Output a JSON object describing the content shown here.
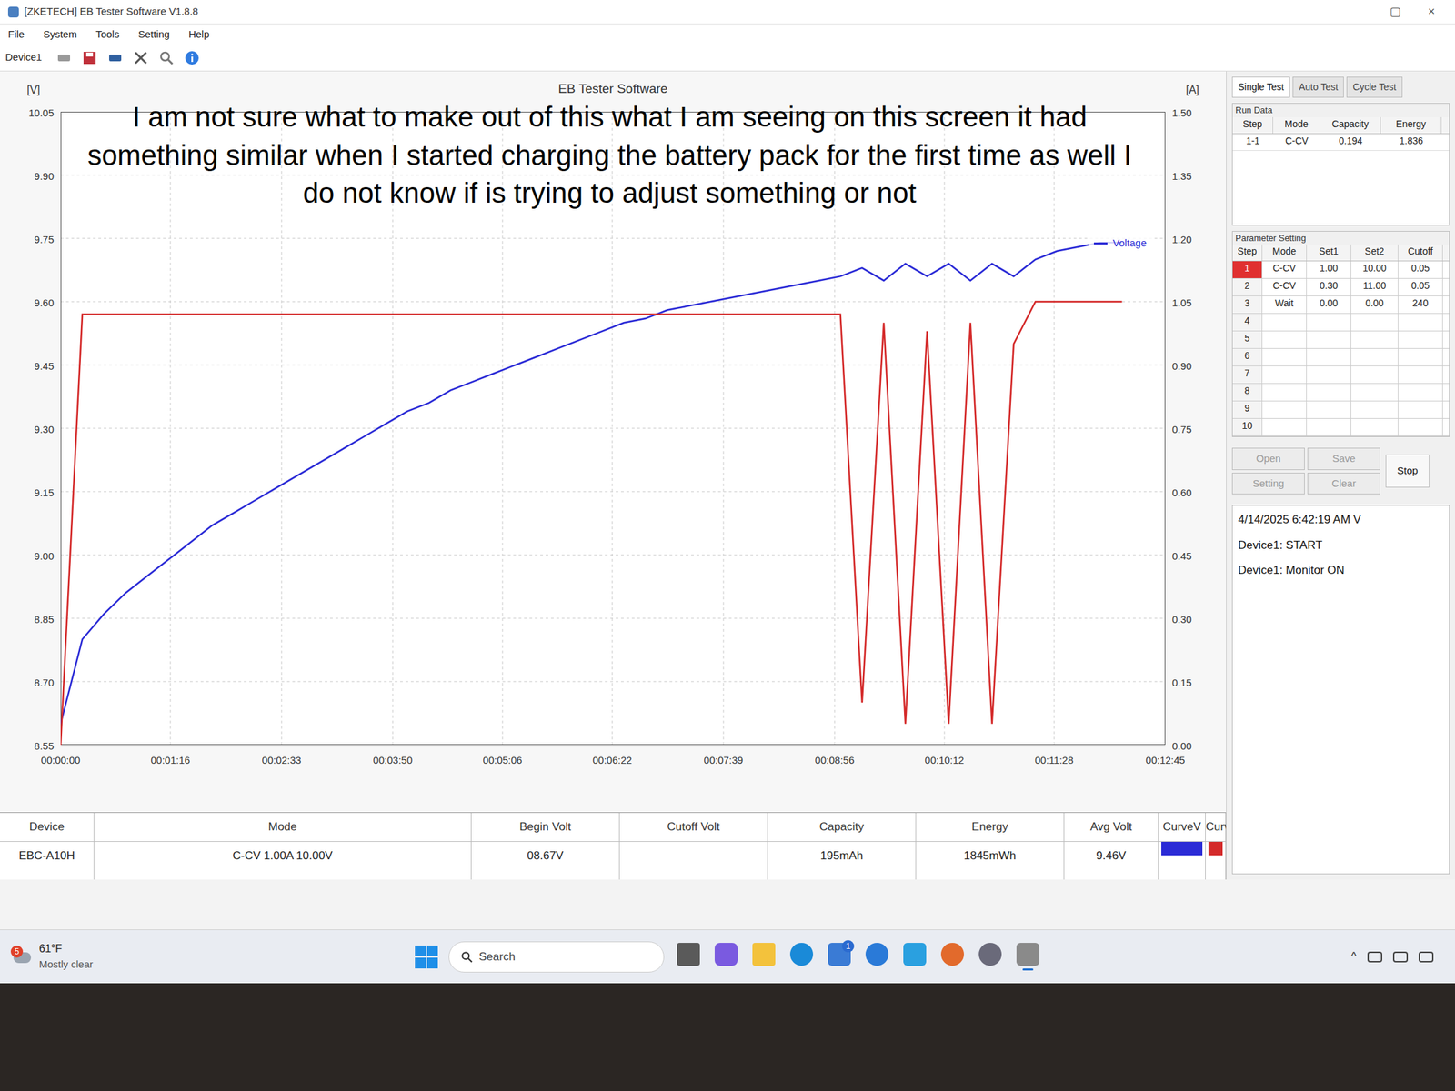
{
  "window": {
    "title": "[ZKETECH] EB Tester Software V1.8.8",
    "controls": [
      "▢",
      "×"
    ]
  },
  "menu": [
    "File",
    "System",
    "Tools",
    "Setting",
    "Help"
  ],
  "toolbar": {
    "device": "Device1"
  },
  "caption": "I am not sure what to make out of this what I am seeing on this screen it had something similar when I started charging the battery pack for the first time as well I do not know if is trying to adjust something or not",
  "chart": {
    "title": "EB Tester Software",
    "left_unit": "[V]",
    "right_unit": "[A]",
    "left_ticks": [
      "8.55",
      "8.70",
      "8.85",
      "9.00",
      "9.15",
      "9.30",
      "9.45",
      "9.60",
      "9.75",
      "9.90",
      "10.05"
    ],
    "right_ticks": [
      "0.00",
      "0.15",
      "0.30",
      "0.45",
      "0.60",
      "0.75",
      "0.90",
      "1.05",
      "1.20",
      "1.35",
      "1.50"
    ],
    "time_ticks": [
      "00:00:00",
      "00:01:16",
      "00:02:33",
      "00:03:50",
      "00:05:06",
      "00:06:22",
      "00:07:39",
      "00:08:56",
      "00:10:12",
      "00:11:28",
      "00:12:45"
    ],
    "series": [
      {
        "legend": "Voltage",
        "axis": "left",
        "color": "#2b2bd6",
        "values": [
          8.6,
          8.8,
          8.86,
          8.91,
          8.95,
          8.99,
          9.03,
          9.07,
          9.1,
          9.13,
          9.16,
          9.19,
          9.22,
          9.25,
          9.28,
          9.31,
          9.34,
          9.36,
          9.39,
          9.41,
          9.43,
          9.45,
          9.47,
          9.49,
          9.51,
          9.53,
          9.55,
          9.56,
          9.58,
          9.59,
          9.6,
          9.61,
          9.62,
          9.63,
          9.64,
          9.65,
          9.66,
          9.68,
          9.65,
          9.69,
          9.66,
          9.69,
          9.65,
          9.69,
          9.66,
          9.7,
          9.72,
          9.73,
          9.74,
          9.74
        ]
      },
      {
        "legend": "",
        "axis": "right",
        "color": "#d42a2a",
        "values": [
          0.0,
          1.02,
          1.02,
          1.02,
          1.02,
          1.02,
          1.02,
          1.02,
          1.02,
          1.02,
          1.02,
          1.02,
          1.02,
          1.02,
          1.02,
          1.02,
          1.02,
          1.02,
          1.02,
          1.02,
          1.02,
          1.02,
          1.02,
          1.02,
          1.02,
          1.02,
          1.02,
          1.02,
          1.02,
          1.02,
          1.02,
          1.02,
          1.02,
          1.02,
          1.02,
          1.02,
          1.02,
          0.1,
          1.0,
          0.05,
          0.98,
          0.05,
          1.0,
          0.05,
          0.95,
          1.05,
          1.05,
          1.05,
          1.05,
          1.05
        ]
      }
    ]
  },
  "summary": {
    "columns": [
      "Device",
      "Mode",
      "Begin Volt",
      "Cutoff Volt",
      "Capacity",
      "Energy",
      "Avg Volt",
      "CurveV",
      "CurveA"
    ],
    "values": [
      "EBC-A10H",
      "C-CV 1.00A 10.00V",
      "08.67V",
      "",
      "195mAh",
      "1845mWh",
      "9.46V"
    ]
  },
  "side_tabs": [
    {
      "label": "Single Test",
      "selected": true
    },
    {
      "label": "Auto Test",
      "selected": false
    },
    {
      "label": "Cycle Test",
      "selected": false
    }
  ],
  "run_data": {
    "title": "Run Data",
    "columns": [
      "Step",
      "Mode",
      "Capacity",
      "Energy"
    ],
    "rows": [
      [
        "1-1",
        "C-CV",
        "0.194",
        "1.836"
      ]
    ]
  },
  "parameters": {
    "title": "Parameter Setting",
    "columns": [
      "Step",
      "Mode",
      "Set1",
      "Set2",
      "Cutoff"
    ],
    "rows": [
      {
        "cells": [
          "1",
          "C-CV",
          "1.00",
          "10.00",
          "0.05"
        ],
        "selected": true
      },
      {
        "cells": [
          "2",
          "C-CV",
          "0.30",
          "11.00",
          "0.05"
        ],
        "selected": false
      },
      {
        "cells": [
          "3",
          "Wait",
          "0.00",
          "0.00",
          "240"
        ],
        "selected": false
      },
      {
        "cells": [
          "4",
          "",
          "",
          "",
          ""
        ],
        "selected": false
      },
      {
        "cells": [
          "5",
          "",
          "",
          "",
          ""
        ],
        "selected": false
      },
      {
        "cells": [
          "6",
          "",
          "",
          "",
          ""
        ],
        "selected": false
      },
      {
        "cells": [
          "7",
          "",
          "",
          "",
          ""
        ],
        "selected": false
      },
      {
        "cells": [
          "8",
          "",
          "",
          "",
          ""
        ],
        "selected": false
      },
      {
        "cells": [
          "9",
          "",
          "",
          "",
          ""
        ],
        "selected": false
      },
      {
        "cells": [
          "10",
          "",
          "",
          "",
          ""
        ],
        "selected": false
      }
    ]
  },
  "buttons": [
    {
      "label": "Open",
      "disabled": true
    },
    {
      "label": "Save",
      "disabled": true
    },
    {
      "label": "Setting",
      "disabled": true
    },
    {
      "label": "Clear",
      "disabled": true
    },
    {
      "label": "Stop",
      "disabled": false
    }
  ],
  "log": [
    "4/14/2025 6:42:19 AM V",
    "Device1: START",
    "Device1: Monitor ON"
  ],
  "taskbar": {
    "weather": {
      "badge": "5",
      "temp": "61°F",
      "condition": "Mostly clear"
    },
    "search": {
      "placeholder": "Search"
    },
    "apps": [
      {
        "kind": "taskview",
        "badge": "",
        "active": false
      },
      {
        "kind": "copilot",
        "badge": "",
        "active": false
      },
      {
        "kind": "files",
        "badge": "",
        "active": false
      },
      {
        "kind": "edge",
        "badge": "",
        "active": false
      },
      {
        "kind": "store",
        "badge": "1",
        "active": false
      },
      {
        "kind": "help",
        "badge": "",
        "active": false
      },
      {
        "kind": "myhp",
        "badge": "",
        "active": false
      },
      {
        "kind": "orange",
        "badge": "",
        "active": false
      },
      {
        "kind": "gray",
        "badge": "",
        "active": false
      },
      {
        "kind": "tester",
        "badge": "",
        "active": true
      }
    ],
    "tray": "^"
  }
}
